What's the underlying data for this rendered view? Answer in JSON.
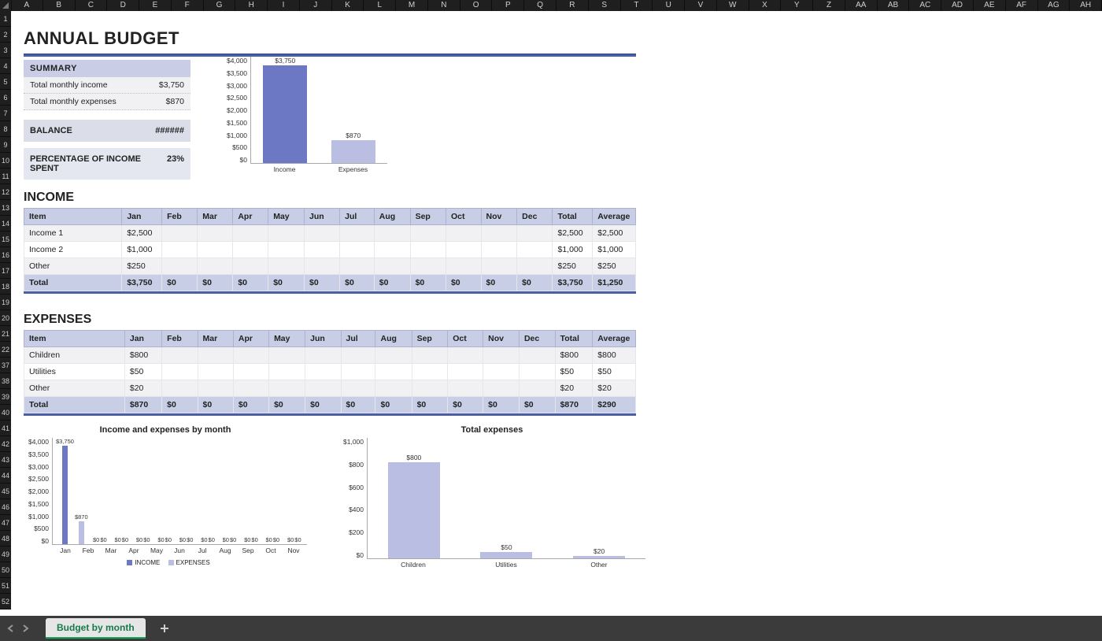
{
  "col_headers": [
    "A",
    "B",
    "C",
    "D",
    "E",
    "F",
    "G",
    "H",
    "I",
    "J",
    "K",
    "L",
    "M",
    "N",
    "O",
    "P",
    "Q",
    "R",
    "S",
    "T",
    "U",
    "V",
    "W",
    "X",
    "Y",
    "Z",
    "AA",
    "AB",
    "AC",
    "AD",
    "AE",
    "AF",
    "AG",
    "AH"
  ],
  "row_headers": [
    "1",
    "2",
    "3",
    "4",
    "5",
    "6",
    "7",
    "8",
    "9",
    "10",
    "11",
    "12",
    "13",
    "14",
    "15",
    "16",
    "17",
    "18",
    "19",
    "20",
    "21",
    "22",
    "37",
    "38",
    "39",
    "40",
    "41",
    "42",
    "43",
    "44",
    "45",
    "46",
    "47",
    "48",
    "49",
    "50",
    "51",
    "52"
  ],
  "title": "ANNUAL BUDGET",
  "summary": {
    "header": "SUMMARY",
    "rows": [
      {
        "label": "Total monthly income",
        "value": "$3,750"
      },
      {
        "label": "Total monthly expenses",
        "value": "$870"
      }
    ],
    "balance_label": "BALANCE",
    "balance_value": "######",
    "pct_label": "PERCENTAGE OF INCOME SPENT",
    "pct_value": "23%"
  },
  "chart_data": [
    {
      "id": "summary_bar",
      "type": "bar",
      "categories": [
        "Income",
        "Expenses"
      ],
      "values": [
        3750,
        870
      ],
      "value_labels": [
        "$3,750",
        "$870"
      ],
      "yticks": [
        "$4,000",
        "$3,500",
        "$3,000",
        "$2,500",
        "$2,000",
        "$1,500",
        "$1,000",
        "$500",
        "$0"
      ],
      "colors": [
        "#6d78c4",
        "#b9bee2"
      ],
      "ylim": [
        0,
        4000
      ]
    },
    {
      "id": "monthly_grouped",
      "type": "bar",
      "title": "Income and expenses by month",
      "categories": [
        "Jan",
        "Feb",
        "Mar",
        "Apr",
        "May",
        "Jun",
        "Jul",
        "Aug",
        "Sep",
        "Oct",
        "Nov"
      ],
      "series": [
        {
          "name": "INCOME",
          "values": [
            3750,
            0,
            0,
            0,
            0,
            0,
            0,
            0,
            0,
            0,
            0
          ],
          "labels": [
            "$3,750",
            "$0",
            "$0",
            "$0",
            "$0",
            "$0",
            "$0",
            "$0",
            "$0",
            "$0",
            "$0"
          ],
          "color": "#6d78c4"
        },
        {
          "name": "EXPENSES",
          "values": [
            870,
            0,
            0,
            0,
            0,
            0,
            0,
            0,
            0,
            0,
            0
          ],
          "labels": [
            "$870",
            "$0",
            "$0",
            "$0",
            "$0",
            "$0",
            "$0",
            "$0",
            "$0",
            "$0",
            "$0"
          ],
          "color": "#b9bee2"
        }
      ],
      "yticks": [
        "$4,000",
        "$3,500",
        "$3,000",
        "$2,500",
        "$2,000",
        "$1,500",
        "$1,000",
        "$500",
        "$0"
      ],
      "ylim": [
        0,
        4000
      ]
    },
    {
      "id": "total_expenses",
      "type": "bar",
      "title": "Total expenses",
      "categories": [
        "Children",
        "Utilities",
        "Other"
      ],
      "values": [
        800,
        50,
        20
      ],
      "value_labels": [
        "$800",
        "$50",
        "$20"
      ],
      "yticks": [
        "$1,000",
        "$800",
        "$600",
        "$400",
        "$200",
        "$0"
      ],
      "color": "#b9bee2",
      "ylim": [
        0,
        1000
      ]
    }
  ],
  "months": [
    "Jan",
    "Feb",
    "Mar",
    "Apr",
    "May",
    "Jun",
    "Jul",
    "Aug",
    "Sep",
    "Oct",
    "Nov",
    "Dec"
  ],
  "extra_cols": [
    "Total",
    "Average"
  ],
  "income": {
    "title": "INCOME",
    "item_header": "Item",
    "rows": [
      {
        "item": "Income 1",
        "values": [
          "$2,500",
          "",
          "",
          "",
          "",
          "",
          "",
          "",
          "",
          "",
          "",
          ""
        ],
        "total": "$2,500",
        "avg": "$2,500"
      },
      {
        "item": "Income 2",
        "values": [
          "$1,000",
          "",
          "",
          "",
          "",
          "",
          "",
          "",
          "",
          "",
          "",
          ""
        ],
        "total": "$1,000",
        "avg": "$1,000"
      },
      {
        "item": "Other",
        "values": [
          "$250",
          "",
          "",
          "",
          "",
          "",
          "",
          "",
          "",
          "",
          "",
          ""
        ],
        "total": "$250",
        "avg": "$250"
      }
    ],
    "total": {
      "item": "Total",
      "values": [
        "$3,750",
        "$0",
        "$0",
        "$0",
        "$0",
        "$0",
        "$0",
        "$0",
        "$0",
        "$0",
        "$0",
        "$0"
      ],
      "total": "$3,750",
      "avg": "$1,250"
    }
  },
  "expenses": {
    "title": "EXPENSES",
    "item_header": "Item",
    "rows": [
      {
        "item": "Children",
        "values": [
          "$800",
          "",
          "",
          "",
          "",
          "",
          "",
          "",
          "",
          "",
          "",
          ""
        ],
        "total": "$800",
        "avg": "$800"
      },
      {
        "item": "Utilities",
        "values": [
          "$50",
          "",
          "",
          "",
          "",
          "",
          "",
          "",
          "",
          "",
          "",
          ""
        ],
        "total": "$50",
        "avg": "$50"
      },
      {
        "item": "Other",
        "values": [
          "$20",
          "",
          "",
          "",
          "",
          "",
          "",
          "",
          "",
          "",
          "",
          ""
        ],
        "total": "$20",
        "avg": "$20"
      }
    ],
    "total": {
      "item": "Total",
      "values": [
        "$870",
        "$0",
        "$0",
        "$0",
        "$0",
        "$0",
        "$0",
        "$0",
        "$0",
        "$0",
        "$0",
        "$0"
      ],
      "total": "$870",
      "avg": "$290"
    }
  },
  "sheet_tab": "Budget by month"
}
